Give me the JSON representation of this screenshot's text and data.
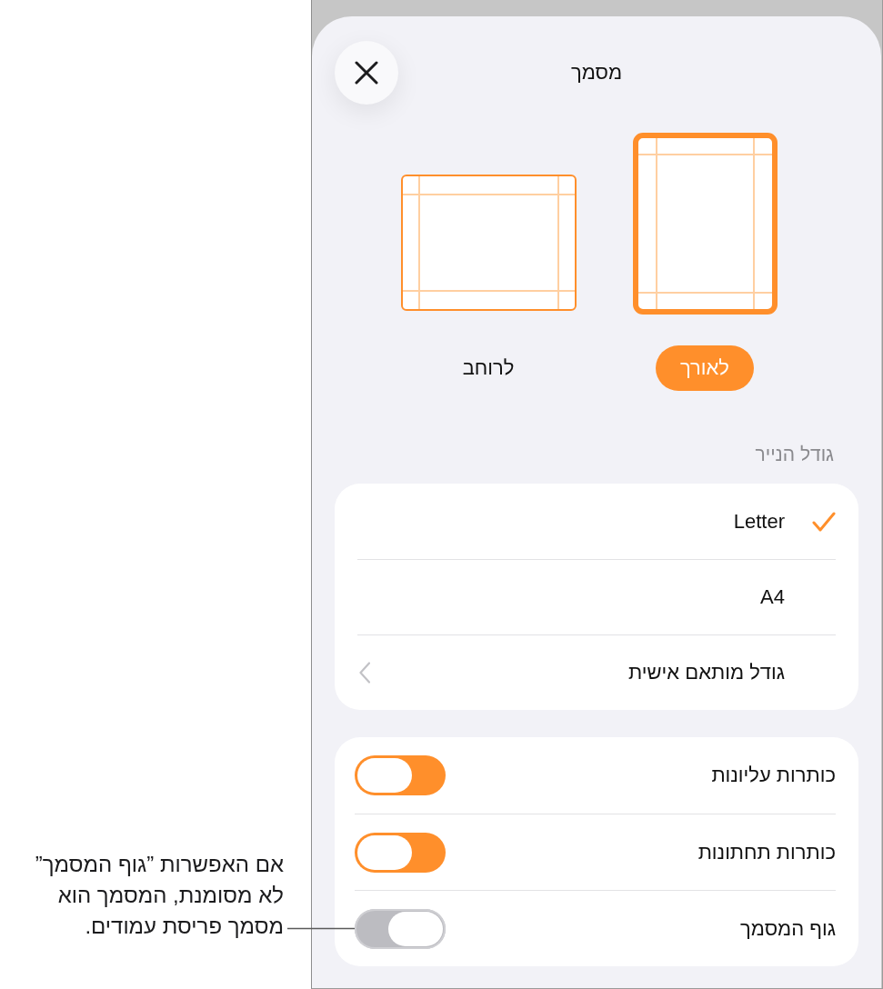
{
  "sheet": {
    "title": "מסמך"
  },
  "orientations": [
    {
      "kind": "portrait",
      "label": "לאורך",
      "selected": true
    },
    {
      "kind": "landscape",
      "label": "לרוחב",
      "selected": false
    }
  ],
  "paper_size": {
    "header": "גודל הנייר",
    "options": [
      {
        "kind": "choice",
        "label": "Letter",
        "selected": true
      },
      {
        "kind": "choice",
        "label": "A4",
        "selected": false
      },
      {
        "kind": "submenu",
        "label": "גודל מותאם אישית",
        "selected": false
      }
    ]
  },
  "settings": [
    {
      "label": "כותרות עליונות",
      "on": true
    },
    {
      "label": "כותרות תחתונות",
      "on": true
    },
    {
      "label": "גוף המסמך",
      "on": false
    }
  ],
  "callout": {
    "text": "אם האפשרות ”גוף המסמך”\nלא מסומנת, המסמך הוא\nמסמך פריסת עמודים."
  }
}
